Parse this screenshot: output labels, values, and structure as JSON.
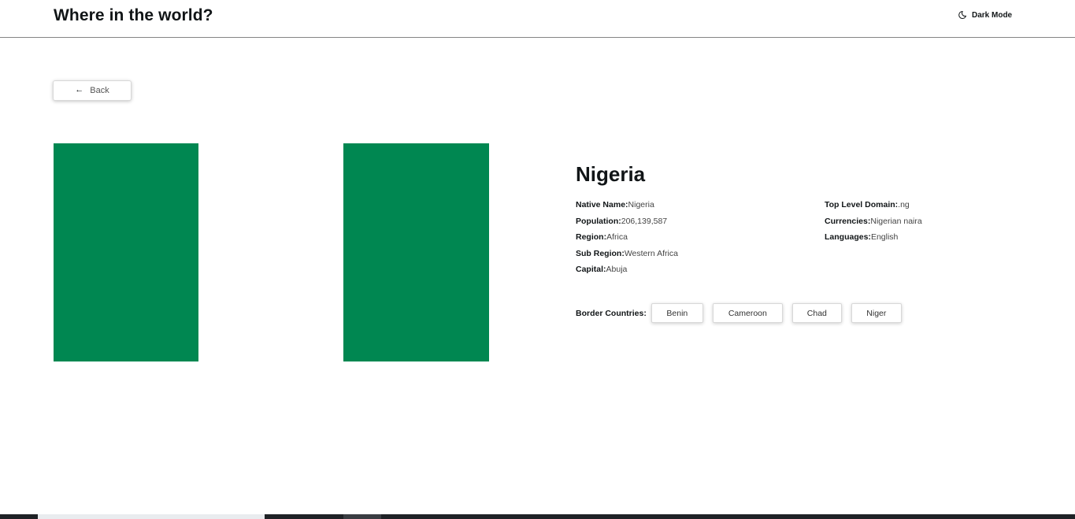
{
  "header": {
    "title": "Where in the world?",
    "dark_mode_label": "Dark Mode",
    "dark_mode_icon": "moon-icon"
  },
  "back_button": {
    "icon": "arrow-left-icon",
    "arrow_glyph": "←",
    "label": "Back"
  },
  "flag": {
    "colors": [
      "#008751",
      "#ffffff",
      "#008751"
    ]
  },
  "country": {
    "name": "Nigeria",
    "details_left": [
      {
        "label": "Native Name:",
        "value": "Nigeria"
      },
      {
        "label": "Population:",
        "value": "206,139,587"
      },
      {
        "label": "Region:",
        "value": "Africa"
      },
      {
        "label": "Sub Region:",
        "value": "Western Africa"
      },
      {
        "label": "Capital:",
        "value": "Abuja"
      }
    ],
    "details_right": [
      {
        "label": "Top Level Domain:",
        "value": ".ng"
      },
      {
        "label": "Currencies:",
        "value": "Nigerian naira"
      },
      {
        "label": "Languages:",
        "value": "English"
      }
    ],
    "border_label": "Border Countries:",
    "borders": [
      "Benin",
      "Cameroon",
      "Chad",
      "Niger"
    ]
  }
}
